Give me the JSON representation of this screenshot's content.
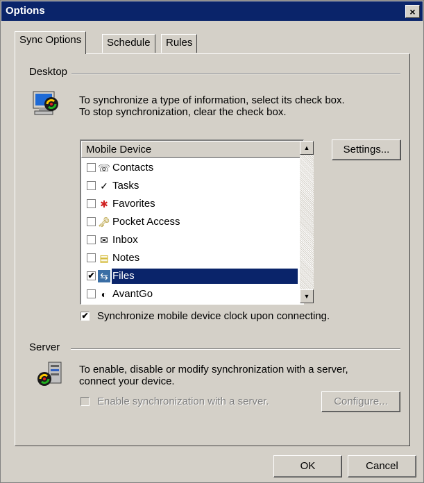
{
  "window": {
    "title": "Options",
    "close_glyph": "×"
  },
  "tabs": [
    {
      "label": "Sync Options",
      "active": true
    },
    {
      "label": "Schedule",
      "active": false
    },
    {
      "label": "Rules",
      "active": false
    }
  ],
  "desktop": {
    "group_label": "Desktop",
    "description_line1": "To synchronize a type of information, select its check box.",
    "description_line2": "To stop synchronization, clear the check box.",
    "list_header": "Mobile Device",
    "settings_button": "Settings...",
    "items": [
      {
        "label": "Contacts",
        "checked": false,
        "icon": "contacts-icon",
        "glyph": "☏",
        "color": "#000000"
      },
      {
        "label": "Tasks",
        "checked": false,
        "icon": "tasks-icon",
        "glyph": "✓",
        "color": "#000000"
      },
      {
        "label": "Favorites",
        "checked": false,
        "icon": "favorites-icon",
        "glyph": "✱",
        "color": "#d02020"
      },
      {
        "label": "Pocket Access",
        "checked": false,
        "icon": "pocket-access-icon",
        "glyph": "🗝",
        "color": "#a08000"
      },
      {
        "label": "Inbox",
        "checked": false,
        "icon": "inbox-icon",
        "glyph": "✉",
        "color": "#000000"
      },
      {
        "label": "Notes",
        "checked": false,
        "icon": "notes-icon",
        "glyph": "▤",
        "color": "#c8a800"
      },
      {
        "label": "Files",
        "checked": true,
        "selected": true,
        "icon": "files-icon",
        "glyph": "⇆",
        "color": "#ffffff"
      },
      {
        "label": "AvantGo",
        "checked": false,
        "icon": "avantgo-icon",
        "glyph": "◐",
        "color": "#000000"
      }
    ],
    "clock_checkbox": {
      "label": "Synchronize mobile device clock upon connecting.",
      "checked": true,
      "check_glyph": "✔"
    }
  },
  "server": {
    "group_label": "Server",
    "description_line1": "To enable, disable or modify synchronization with a server,",
    "description_line2": "connect your device.",
    "enable_checkbox": {
      "label": "Enable synchronization with a server.",
      "checked": false,
      "disabled": true
    },
    "configure_button": "Configure..."
  },
  "footer": {
    "ok_button": "OK",
    "cancel_button": "Cancel"
  },
  "colors": {
    "title_bar": "#0a246a",
    "face": "#d4d0c8",
    "selection": "#0a246a"
  }
}
